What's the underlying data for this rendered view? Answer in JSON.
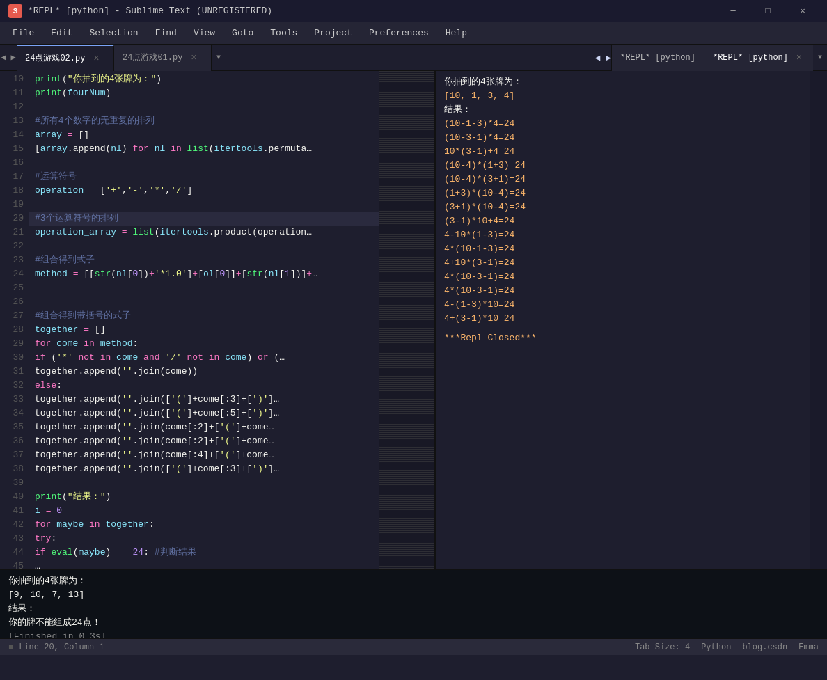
{
  "titleBar": {
    "icon": "S",
    "title": "*REPL* [python] - Sublime Text (UNREGISTERED)",
    "minimize": "—",
    "maximize": "□",
    "close": "✕"
  },
  "menuBar": {
    "items": [
      "File",
      "Edit",
      "Selection",
      "Find",
      "View",
      "Goto",
      "Tools",
      "Project",
      "Preferences",
      "Help"
    ]
  },
  "tabs": {
    "left": [
      {
        "label": "24点游戏02.py",
        "active": true
      },
      {
        "label": "24点游戏01.py",
        "active": false
      }
    ],
    "right": [
      {
        "label": "*REPL* [python]",
        "active": false
      },
      {
        "label": "*REPL* [python]",
        "active": true
      }
    ]
  },
  "statusBar": {
    "indicator": "■",
    "position": "Line 20, Column 1",
    "tabSize": "Tab Size: 4",
    "language": "Python",
    "site": "blog.csdn",
    "author": "Emma"
  },
  "terminalOutput": {
    "line1": "你抽到的4张牌为：",
    "line2": "[9, 10, 7, 13]",
    "line3": "结果：",
    "line4": "你的牌不能组成24点！",
    "line5": "[Finished in 0.3s]"
  },
  "rightOutput": {
    "line1": "你抽到的4张牌为：",
    "line2": "[10, 1, 3, 4]",
    "line3": "结果：",
    "expressions": [
      "(10-1-3)*4=24",
      "(10-3-1)*4=24",
      "10*(3-1)+4=24",
      "(10-4)*(1+3)=24",
      "(10-4)*(3+1)=24",
      "(1+3)*(10-4)=24",
      "(3+1)*(10-4)=24",
      "(3-1)*10+4=24",
      "4-10*(1-3)=24",
      "4*(10-1-3)=24",
      "4+10*(3-1)=24",
      "4*(10-3-1)=24",
      "4*(10-3-1)=24",
      "4-(1-3)*10=24",
      "4+(3-1)*10=24"
    ],
    "closed": "***Repl Closed***"
  }
}
